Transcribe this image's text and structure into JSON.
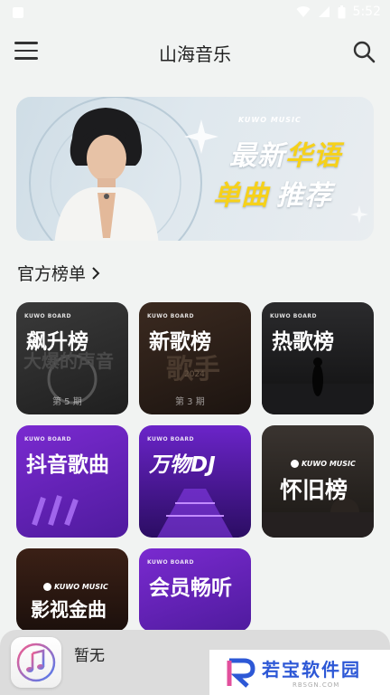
{
  "status_bar": {
    "time": "5:52"
  },
  "app_bar": {
    "title": "山海音乐"
  },
  "banner": {
    "brand": "KUWO MUSIC",
    "line1_white": "最新",
    "line1_yellow": "华语",
    "line2_yellow": "单曲",
    "line2_white": "推荐"
  },
  "section": {
    "title": "官方榜单"
  },
  "charts": [
    {
      "title": "飙升榜",
      "board": "KUWO BOARD",
      "sub": "第 5 期"
    },
    {
      "title": "新歌榜",
      "board": "KUWO BOARD",
      "sub": "第 3 期"
    },
    {
      "title": "热歌榜",
      "board": "KUWO BOARD",
      "sub": ""
    },
    {
      "title": "抖音歌曲",
      "board": "KUWO BOARD",
      "sub": ""
    },
    {
      "title": "万物DJ",
      "board": "KUWO BOARD",
      "sub": ""
    },
    {
      "title": "怀旧榜",
      "board": "KUWO MUSIC",
      "sub": ""
    },
    {
      "title": "影视金曲",
      "board": "KUWO MUSIC",
      "sub": ""
    },
    {
      "title": "会员畅听",
      "board": "KUWO BOARD",
      "sub": ""
    }
  ],
  "player": {
    "now_playing": "暂无"
  },
  "watermark": {
    "text": "若宝软件园",
    "url": "RBSGN.COM"
  },
  "colors": {
    "accent_yellow": "#f6d11a",
    "watermark_blue": "#2d58d6"
  }
}
